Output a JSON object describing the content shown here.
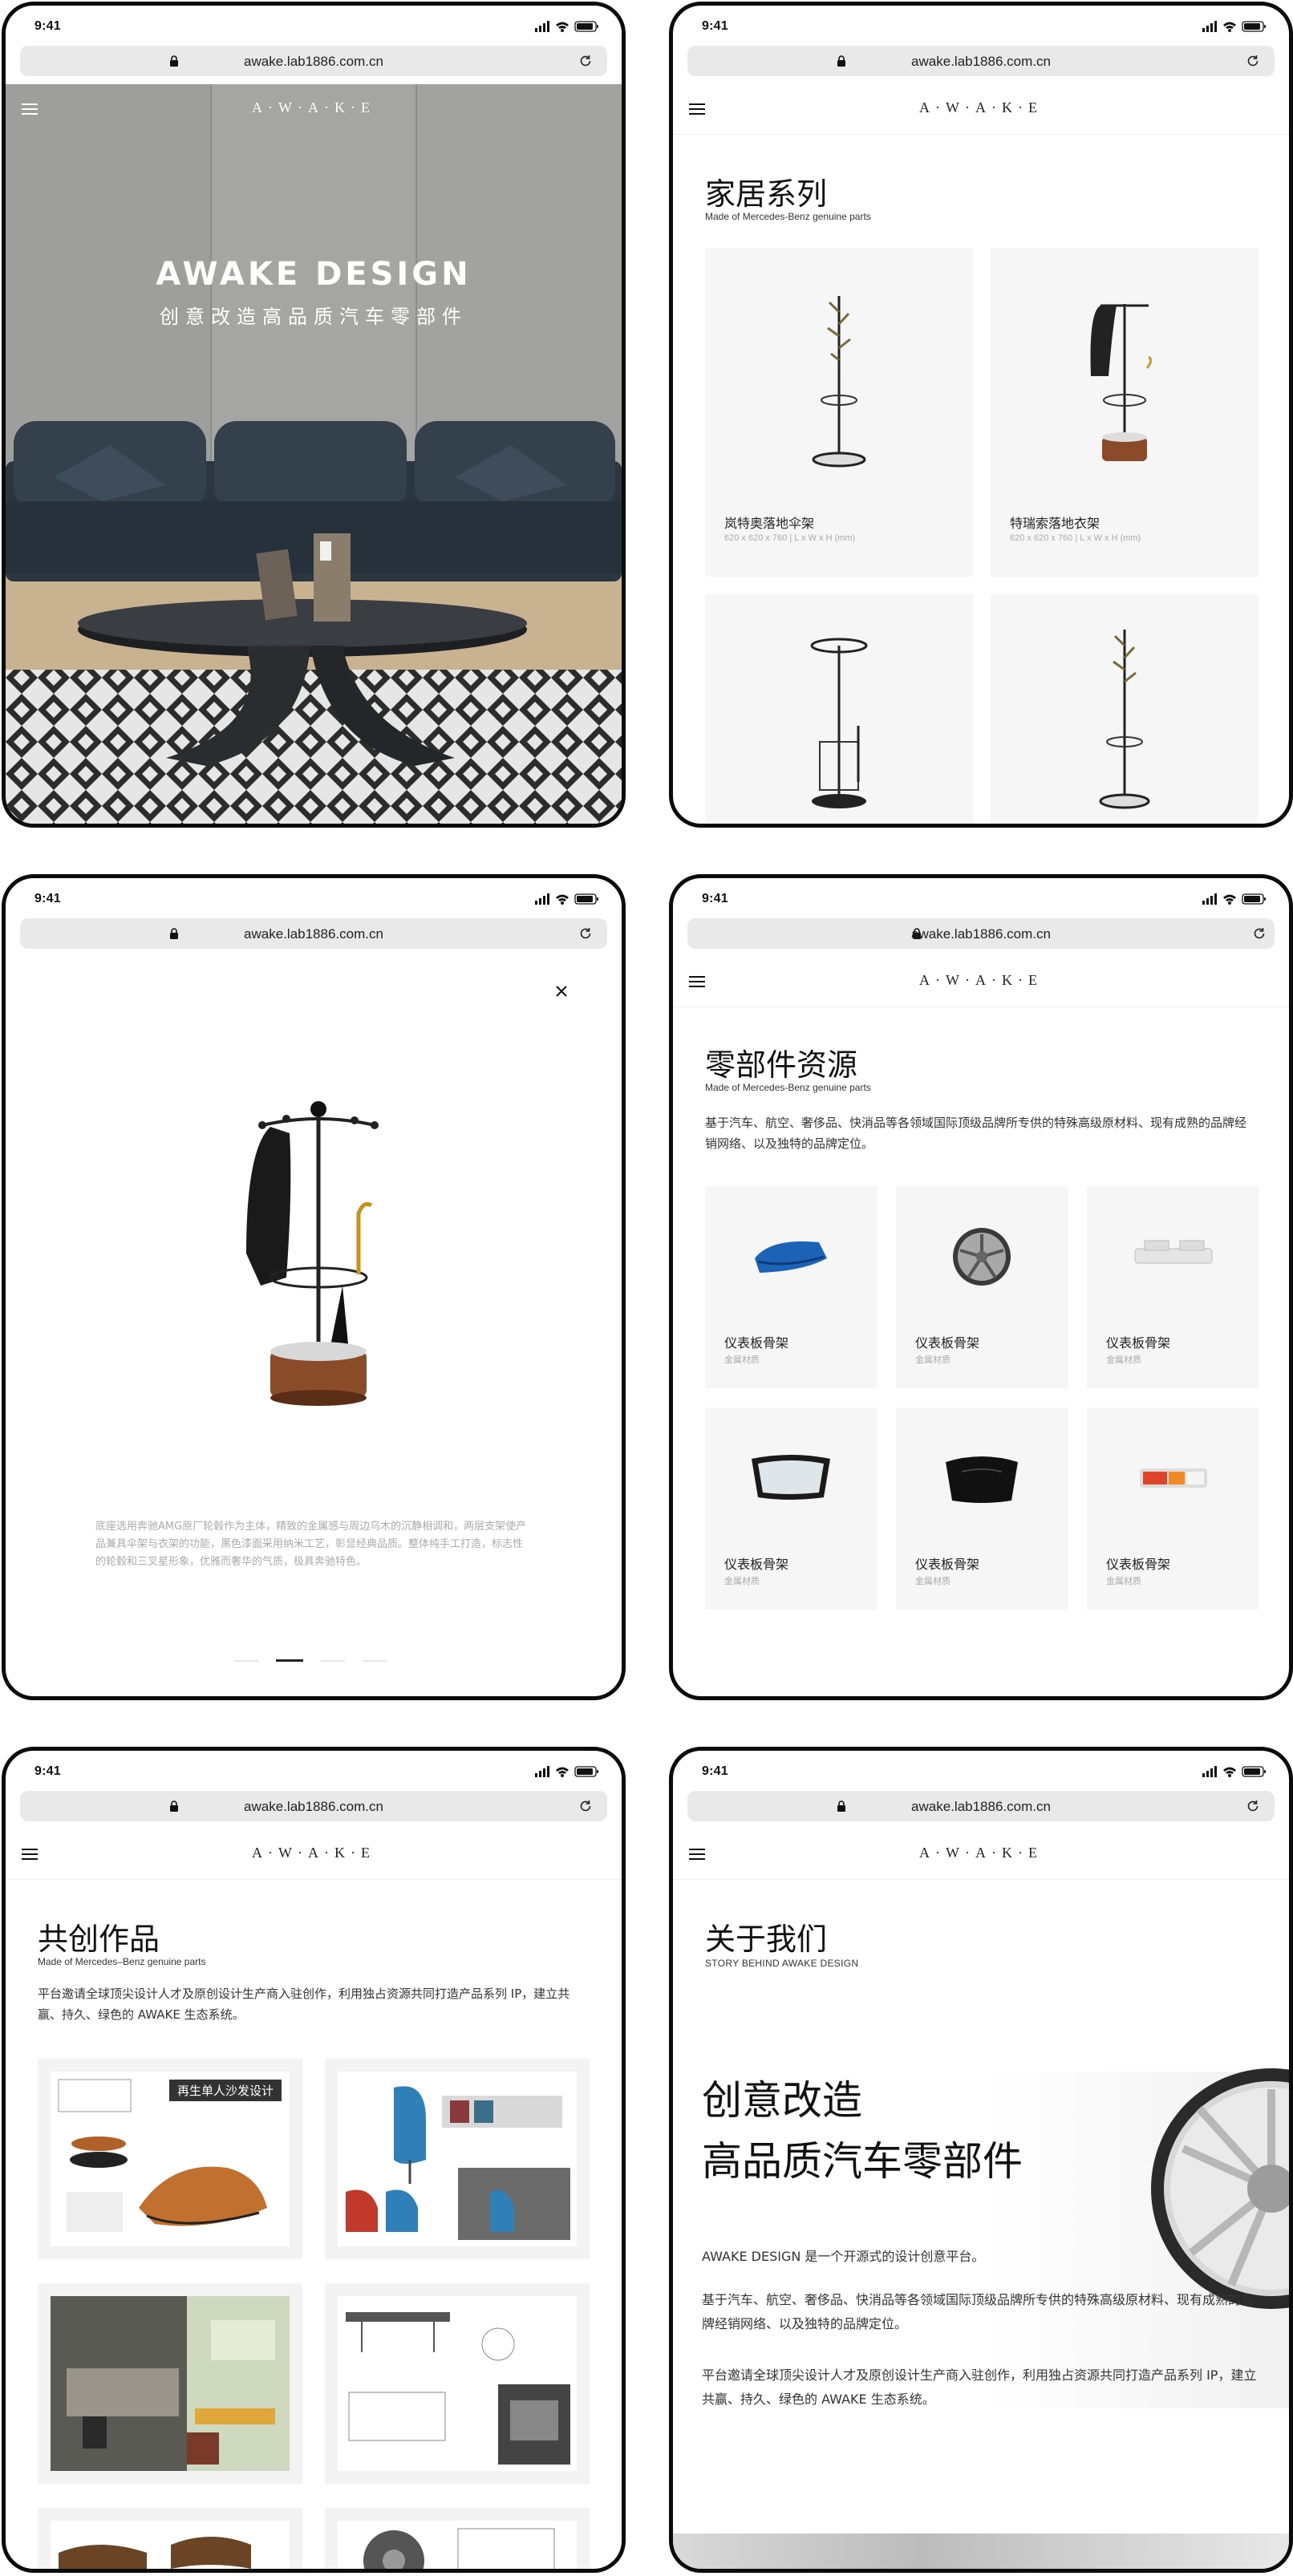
{
  "status": {
    "time": "9:41"
  },
  "browser": {
    "url": "awake.lab1886.com.cn"
  },
  "nav": {
    "logo": "A·W·A·K·E"
  },
  "hero": {
    "title": "AWAKE DESIGN",
    "subtitle": "创意改造高品质汽车零部件"
  },
  "home": {
    "title": "家居系列",
    "subtitle": "Made of Mercedes-Benz genuine parts",
    "products": [
      {
        "name": "岚特奥落地伞架",
        "spec": "620 x 620 x 760 | L x W x H (mm)"
      },
      {
        "name": "特瑞索落地衣架",
        "spec": "620 x 620 x 760 | L x W x H (mm)"
      },
      {
        "name": "",
        "spec": ""
      },
      {
        "name": "",
        "spec": ""
      }
    ]
  },
  "detail": {
    "description": "底座选用奔驰AMG原厂轮毂作为主体，精致的金属感与周边乌木的沉静相调和，两层支架使产品兼具伞架与衣架的功能，黑色漆面采用纳米工艺，彰显经典品质。整体纯手工打造，标志性的轮毂和三叉星形象，优雅而奢华的气质，极具奔驰特色。"
  },
  "parts": {
    "title": "零部件资源",
    "subtitle": "Made of Mercedes-Benz genuine parts",
    "description": "基于汽车、航空、奢侈品、快消品等各领域国际顶级品牌所专供的特殊高级原材料、现有成熟的品牌经销网络、以及独特的品牌定位。",
    "items": [
      {
        "name": "仪表板骨架",
        "material": "金属材质",
        "icon": "blue-car-panel"
      },
      {
        "name": "仪表板骨架",
        "material": "金属材质",
        "icon": "alloy-wheel"
      },
      {
        "name": "仪表板骨架",
        "material": "金属材质",
        "icon": "dashboard-frame"
      },
      {
        "name": "仪表板骨架",
        "material": "金属材质",
        "icon": "windshield"
      },
      {
        "name": "仪表板骨架",
        "material": "金属材质",
        "icon": "car-hood"
      },
      {
        "name": "仪表板骨架",
        "material": "金属材质",
        "icon": "tail-light"
      }
    ]
  },
  "works": {
    "title": "共创作品",
    "subtitle": "Made of Mercedes–Benz genuine parts",
    "description": "平台邀请全球顶尖设计人才及原创设计生产商入驻创作，利用独占资源共同打造产品系列 IP，建立共赢、持久、绿色的 AWAKE 生态系统。",
    "card1_tag": "再生单人沙发设计"
  },
  "about": {
    "title": "关于我们",
    "subtitle": "STORY BEHIND AWAKE DESIGN",
    "headline_line1": "创意改造",
    "headline_line2": "高品质汽车零部件",
    "p1": "AWAKE DESIGN 是一个开源式的设计创意平台。",
    "p2": "基于汽车、航空、奢侈品、快消品等各领域国际顶级品牌所专供的特殊高级原材料、现有成熟的品牌经销网络、以及独特的品牌定位。",
    "p3": "平台邀请全球顶尖设计人才及原创设计生产商入驻创作，利用独占资源共同打造产品系列 IP，建立共赢、持久、绿色的 AWAKE 生态系统。"
  },
  "colors": {
    "accent": "#111111",
    "card_bg": "#f6f6f6",
    "url_bg": "#e9e9ea"
  }
}
